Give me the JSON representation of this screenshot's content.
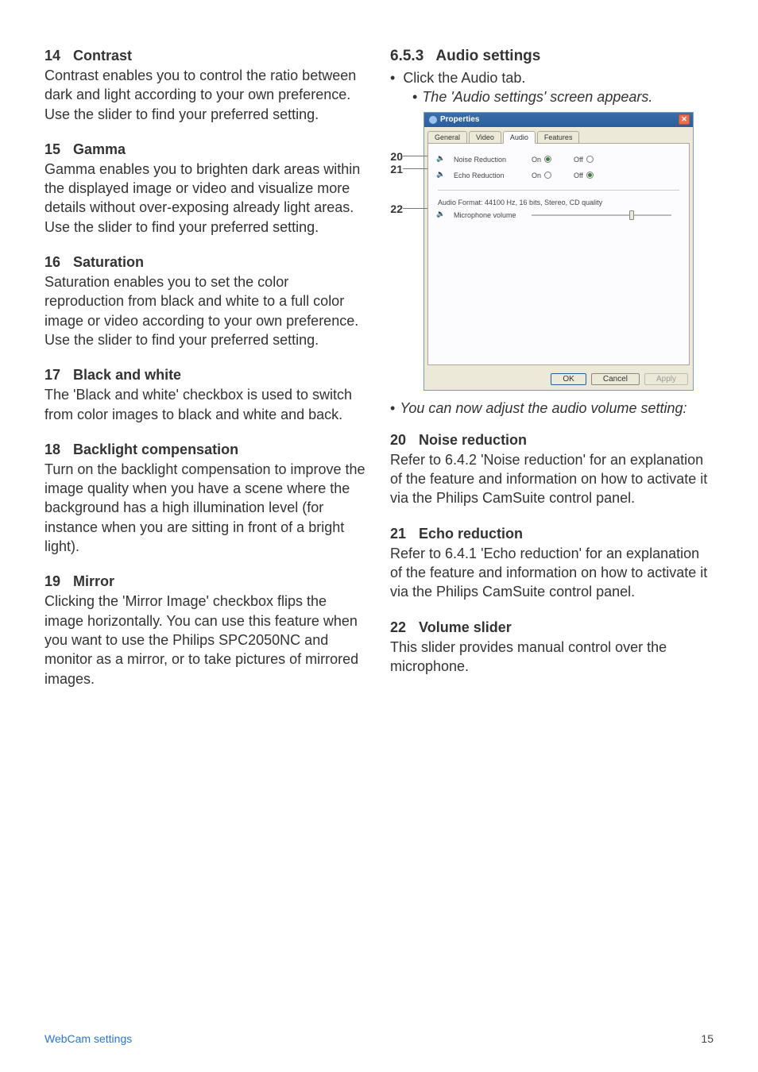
{
  "left": {
    "sections": [
      {
        "num": "14",
        "title": "Contrast",
        "body": "Contrast enables you to control the ratio between dark and light according to your own preference. Use the slider to find your preferred setting."
      },
      {
        "num": "15",
        "title": "Gamma",
        "body": "Gamma enables you to brighten dark areas within the displayed image or video and visualize more details without over-exposing already light areas. Use the slider to find your preferred setting."
      },
      {
        "num": "16",
        "title": "Saturation",
        "body": "Saturation enables you to set the color reproduction from black and white to a full color image or video according to your own preference. Use the slider to find your preferred setting."
      },
      {
        "num": "17",
        "title": "Black and white",
        "body": "The 'Black and white' checkbox is used to switch from color images to black and white and back."
      },
      {
        "num": "18",
        "title": "Backlight compensation",
        "body": "Turn on the backlight compensation to improve the image quality when you have a scene where the background has a high illumination level (for instance when you are sitting in front of a bright light)."
      },
      {
        "num": "19",
        "title": "Mirror",
        "body": "Clicking the 'Mirror Image' checkbox flips the image horizontally. You can use this feature when you want to use the Philips SPC2050NC and monitor as a mirror, or to take pictures of mirrored images."
      }
    ]
  },
  "right": {
    "heading_num": "6.5.3",
    "heading_title": "Audio settings",
    "click_text": "Click the Audio tab.",
    "sub_bullet": "The 'Audio settings' screen appears.",
    "post_dialog_italic": "You can now adjust the audio volume setting:",
    "sections": [
      {
        "num": "20",
        "title": "Noise reduction",
        "body": "Refer to 6.4.2 'Noise reduction' for an explanation of the feature and information on how to activate it via the Philips CamSuite control panel."
      },
      {
        "num": "21",
        "title": "Echo reduction",
        "body": "Refer to 6.4.1 'Echo reduction' for an explanation of the feature and information on how to activate it via the Philips CamSuite control panel."
      },
      {
        "num": "22",
        "title": "Volume slider",
        "body": "This slider provides manual control over the microphone."
      }
    ]
  },
  "dialog": {
    "title": "Properties",
    "tabs": {
      "general": "General",
      "video": "Video",
      "audio": "Audio",
      "features": "Features"
    },
    "rows": {
      "noise": "Noise Reduction",
      "echo": "Echo Reduction",
      "on": "On",
      "off": "Off"
    },
    "format": "Audio Format: 44100 Hz, 16 bits, Stereo, CD quality",
    "mic_label": "Microphone volume",
    "buttons": {
      "ok": "OK",
      "cancel": "Cancel",
      "apply": "Apply"
    }
  },
  "callouts": {
    "c20": "20",
    "c21": "21",
    "c22": "22"
  },
  "footer": {
    "left": "WebCam settings",
    "right": "15"
  }
}
